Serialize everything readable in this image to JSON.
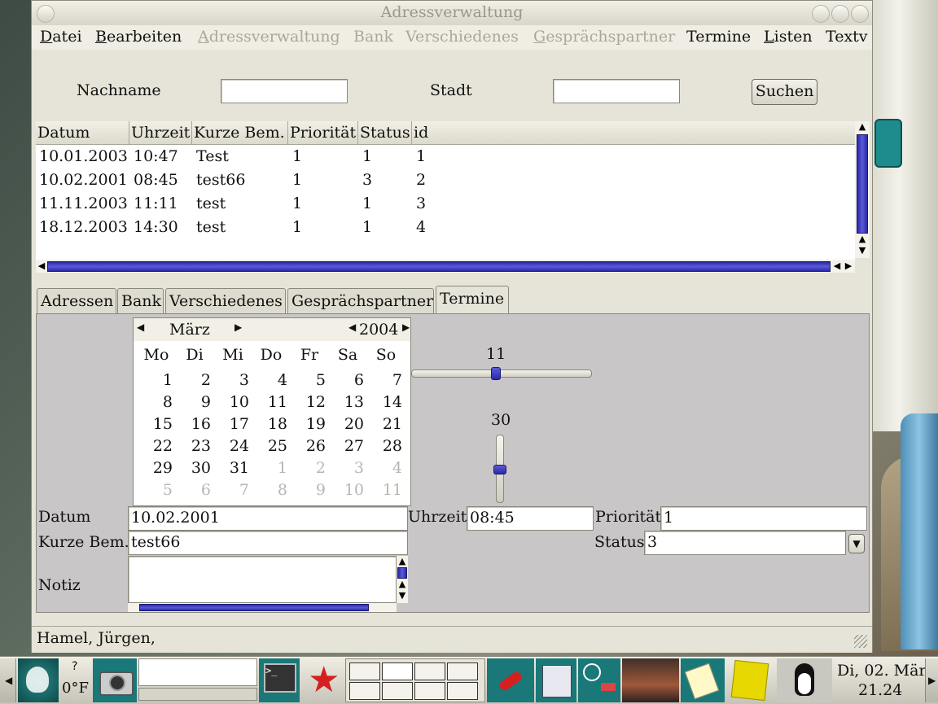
{
  "window": {
    "title": "Adressverwaltung"
  },
  "menu": [
    {
      "label": "Datei",
      "ul": "D",
      "rest": "atei",
      "disabled": false
    },
    {
      "label": "Bearbeiten",
      "ul": "B",
      "rest": "earbeiten",
      "disabled": false
    },
    {
      "label": "Adressverwaltung",
      "ul": "A",
      "rest": "dressverwaltung",
      "disabled": true
    },
    {
      "label": "Bank",
      "ul": "",
      "rest": "Bank",
      "disabled": true
    },
    {
      "label": "Verschiedenes",
      "ul": "",
      "rest": "Verschiedenes",
      "disabled": true
    },
    {
      "label": "Gesprächspartner",
      "ul": "G",
      "rest": "esprächspartner",
      "disabled": true
    },
    {
      "label": "Termine",
      "ul": "",
      "rest": "Termine",
      "disabled": false
    },
    {
      "label": "Listen",
      "ul": "L",
      "rest": "isten",
      "disabled": false
    },
    {
      "label": "Textv",
      "ul": "",
      "rest": "Textv",
      "disabled": false
    }
  ],
  "search": {
    "nachname_label": "Nachname",
    "nachname_value": "",
    "stadt_label": "Stadt",
    "stadt_value": "",
    "button": "Suchen"
  },
  "table": {
    "columns": [
      "Datum",
      "Uhrzeit",
      "Kurze Bem.",
      "Priorität",
      "Status",
      "id"
    ],
    "rows": [
      [
        "10.01.2003",
        "10:47",
        "Test",
        "1",
        "1",
        "1"
      ],
      [
        "10.02.2001",
        "08:45",
        "test66",
        "1",
        "3",
        "2"
      ],
      [
        "11.11.2003",
        "11:11",
        "test",
        "1",
        "1",
        "3"
      ],
      [
        "18.12.2003",
        "14:30",
        "test",
        "1",
        "1",
        "4"
      ]
    ]
  },
  "tabs": [
    "Adressen",
    "Bank",
    "Verschiedenes",
    "Gesprächspartner",
    "Termine"
  ],
  "active_tab": "Termine",
  "calendar": {
    "month": "März",
    "year": "2004",
    "weekdays": [
      "Mo",
      "Di",
      "Mi",
      "Do",
      "Fr",
      "Sa",
      "So"
    ],
    "weeks": [
      [
        [
          "1",
          false
        ],
        [
          "2",
          false
        ],
        [
          "3",
          false
        ],
        [
          "4",
          false
        ],
        [
          "5",
          false
        ],
        [
          "6",
          false
        ],
        [
          "7",
          false
        ]
      ],
      [
        [
          "8",
          false
        ],
        [
          "9",
          false
        ],
        [
          "10",
          false
        ],
        [
          "11",
          false
        ],
        [
          "12",
          false
        ],
        [
          "13",
          false
        ],
        [
          "14",
          false
        ]
      ],
      [
        [
          "15",
          false
        ],
        [
          "16",
          false
        ],
        [
          "17",
          false
        ],
        [
          "18",
          false
        ],
        [
          "19",
          false
        ],
        [
          "20",
          false
        ],
        [
          "21",
          false
        ]
      ],
      [
        [
          "22",
          false
        ],
        [
          "23",
          false
        ],
        [
          "24",
          false
        ],
        [
          "25",
          false
        ],
        [
          "26",
          false
        ],
        [
          "27",
          false
        ],
        [
          "28",
          false
        ]
      ],
      [
        [
          "29",
          false
        ],
        [
          "30",
          false
        ],
        [
          "31",
          false
        ],
        [
          "1",
          true
        ],
        [
          "2",
          true
        ],
        [
          "3",
          true
        ],
        [
          "4",
          true
        ]
      ],
      [
        [
          "5",
          true
        ],
        [
          "6",
          true
        ],
        [
          "7",
          true
        ],
        [
          "8",
          true
        ],
        [
          "9",
          true
        ],
        [
          "10",
          true
        ],
        [
          "11",
          true
        ]
      ]
    ]
  },
  "hour_slider": {
    "value": "11",
    "fraction": 0.46
  },
  "minute_slider": {
    "value": "30",
    "fraction": 0.5
  },
  "form": {
    "datum_label": "Datum",
    "datum_value": "10.02.2001",
    "uhrzeit_label": "Uhrzeit",
    "uhrzeit_value": "08:45",
    "prioritaet_label": "Priorität",
    "prioritaet_value": "1",
    "kurze_label": "Kurze Bem.",
    "kurze_value": "test66",
    "status_label": "Status",
    "status_value": "3",
    "notiz_label": "Notiz",
    "notiz_value": ""
  },
  "statusbar": {
    "text": "Hamel, Jürgen,"
  },
  "panel": {
    "temp_top": "?",
    "temperature": "0°F",
    "clock_date": "Di, 02. Mär",
    "clock_time": "21.24"
  },
  "colors": {
    "accent": "#2a2aa8",
    "window_bg": "#e6e4d8",
    "panel_bg": "#c8c6c6"
  }
}
